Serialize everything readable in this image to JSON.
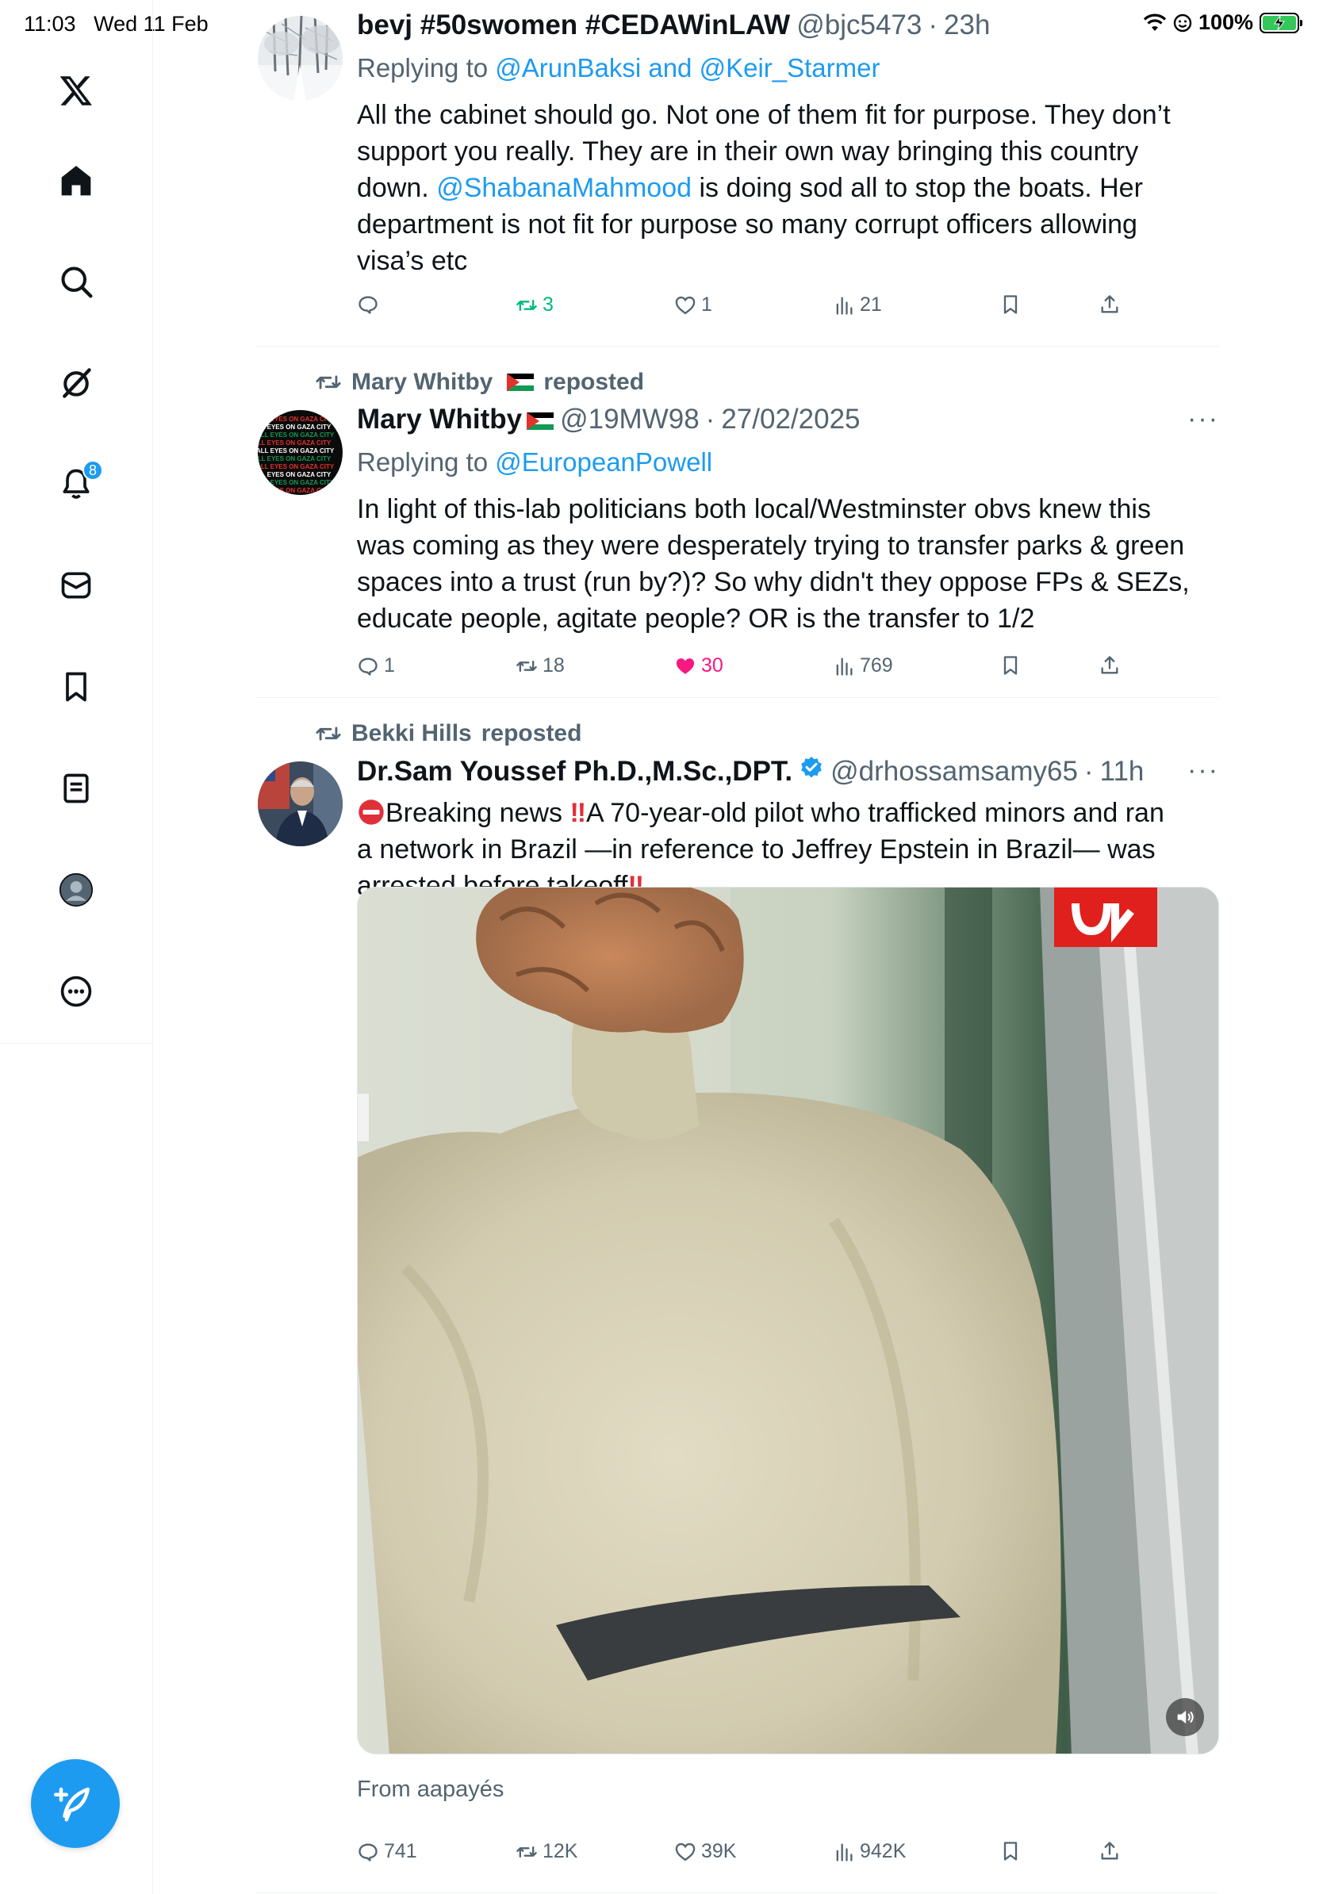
{
  "status_bar": {
    "time": "11:03",
    "date": "Wed 11 Feb",
    "battery": "100%"
  },
  "sidebar": {
    "items": [
      {
        "name": "x-logo-icon"
      },
      {
        "name": "home-icon"
      },
      {
        "name": "search-icon"
      },
      {
        "name": "grok-icon"
      },
      {
        "name": "notifications-icon",
        "badge": "8"
      },
      {
        "name": "messages-icon"
      },
      {
        "name": "bookmarks-icon"
      },
      {
        "name": "lists-icon"
      },
      {
        "name": "profile-icon"
      },
      {
        "name": "more-icon"
      }
    ],
    "compose_icon": "compose-icon"
  },
  "tweets": [
    {
      "name": "bevj #50swomen #CEDAWinLAW",
      "handle": "@bjc5473",
      "time": "23h",
      "reply_prefix": "Replying to",
      "reply_to": "@ArunBaksi and @Keir_Starmer",
      "lines": [
        "All the cabinet should go. Not one of them fit for purpose. They don’t",
        "support you really. They are in their own way bringing this country",
        "down. ",
        "department is not fit for purpose so many corrupt officers allowing",
        "visa’s etc"
      ],
      "mention": "@ShabanaMahmood",
      "line3_tail": " is doing sod all to stop the boats. Her",
      "actions": {
        "replies": "",
        "reposts": "3",
        "likes": "1",
        "views": "21"
      }
    },
    {
      "repost_by": "Mary Whitby",
      "repost_label": "reposted",
      "name": "Mary Whitby",
      "handle": "@19MW98",
      "time": "27/02/2025",
      "reply_prefix": "Replying to",
      "reply_to": "@EuropeanPowell",
      "lines": [
        "In light of this-lab politicians both local/Westminster obvs knew this",
        "was coming as they were desperately trying to transfer parks & green",
        "spaces into a trust (run by?)?  So why didn't they oppose FPs & SEZs,",
        "educate people, agitate people? OR is the transfer to 1/2"
      ],
      "more": "···",
      "avatar_text": "ALL EYES ON GAZA CITY",
      "actions": {
        "replies": "1",
        "reposts": "18",
        "likes": "30",
        "views": "769"
      }
    },
    {
      "repost_by": "Bekki Hills",
      "repost_label": "reposted",
      "name": "Dr.Sam Youssef Ph.D.,M.Sc.,DPT.",
      "handle": "@drhossamsamy65",
      "time": "11h",
      "lines": [
        "Breaking news ",
        "a network in Brazil —in reference to Jeffrey Epstein in Brazil— was",
        "arrested before takeoff"
      ],
      "line1_tail": "A 70-year-old pilot who trafficked minors and ran",
      "more": "···",
      "source": "From aapayés",
      "actions": {
        "replies": "741",
        "reposts": "12K",
        "likes": "39K",
        "views": "942K"
      }
    }
  ],
  "colors": {
    "accent": "#1d9bf0",
    "text_secondary": "#536471",
    "repost_green": "#00ba7c",
    "like_pink": "#f91880"
  }
}
